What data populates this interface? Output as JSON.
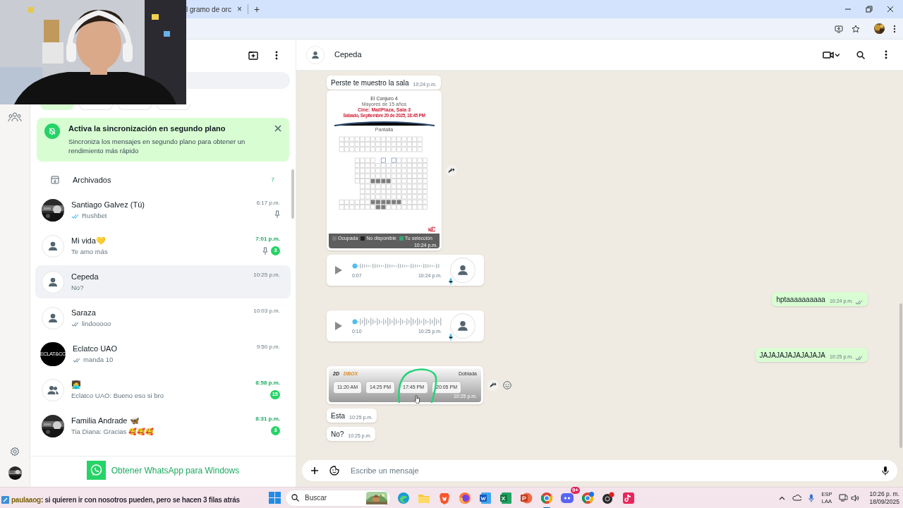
{
  "browser": {
    "tab_title": "l gramo de orc",
    "tab_close": "×",
    "new_tab": "+"
  },
  "stream_chat": {
    "user": "paulaaog",
    "text": ": si quieren ir con nosotros pueden, pero se hacen 3 filas atrás"
  },
  "sidebar": {
    "filters": [
      {
        "selected": true
      },
      {
        "selected": false
      },
      {
        "selected": false
      },
      {
        "selected": false
      }
    ],
    "sync_banner": {
      "title": "Activa la sincronización en segundo plano",
      "text": "Sincroniza los mensajes en segundo plano para obtener un rendimiento más rápido"
    },
    "archived": {
      "label": "Archivados",
      "count": "7"
    },
    "chats": [
      {
        "name": "Santiago Galvez (Tú)",
        "preview": "Rushbet",
        "time": "6:17 p.m.",
        "ticks_read": true,
        "pinned": true,
        "selected": false
      },
      {
        "name": "Mi vida💛",
        "preview": "Te amo más",
        "time": "7:01 p.m.",
        "avatar": {
          "kind": "person"
        },
        "pinned": true,
        "unread": "3",
        "selected": false
      },
      {
        "name": "Cepeda",
        "preview": "No?",
        "time": "10:25 p.m.",
        "avatar": {
          "kind": "person"
        },
        "pinned": false,
        "selected": true
      },
      {
        "name": "Saraza",
        "preview": "lindooooo",
        "time": "10:03 p.m.",
        "avatar": {
          "kind": "person"
        },
        "ticks_read": false,
        "pinned": false,
        "selected": false
      },
      {
        "name": "Eclatco UAO",
        "preview": "manda 10",
        "time": "9:50 p.m.",
        "avatar": {
          "kind": "logo",
          "text": "ECLAT&CO"
        },
        "ticks_read": false,
        "pinned": false,
        "selected": false
      },
      {
        "name": "🧑‍💻",
        "preview": "Eclatco UAO: Bueno eso si bro",
        "time": "8:58 p.m.",
        "avatar": {
          "kind": "group"
        },
        "pinned": false,
        "unread": "15",
        "selected": false
      },
      {
        "name": "Familia Andrade 🦋",
        "preview": "Tia Diana: Gracias 🥰🥰🥰",
        "time": "8:31 p.m.",
        "pinned": false,
        "unread": "3",
        "selected": false
      }
    ],
    "footer": "Obtener WhatsApp para Windows"
  },
  "chat": {
    "name": "Cepeda",
    "messages": [
      {
        "kind": "text",
        "outgoing": false,
        "text": "Perste te muestro la sala",
        "time": "10:24 p.m."
      },
      {
        "kind": "seat_map",
        "outgoing": false,
        "title": "El Conjuro 4",
        "rating": "Mayores de 15 años",
        "cinema": "Cine: MallPlaza, Sala 3",
        "date": "Sábado, Septiembre 20 de 2025, 18:45 PM",
        "screen": "Pantalla",
        "legend": [
          {
            "label": "Ocupada",
            "color": "#7a7a7a"
          },
          {
            "label": "No disponible",
            "color": "#222222"
          },
          {
            "label": "Tu selección",
            "color": "#3aa57a"
          }
        ],
        "time": "10:24 p.m."
      },
      {
        "kind": "voice",
        "outgoing": false,
        "duration": "0:07",
        "time": "10:24 p.m."
      },
      {
        "kind": "text",
        "outgoing": true,
        "text": "hptaaaaaaaaaa",
        "time": "10:24 p.m.",
        "ticks_read": false
      },
      {
        "kind": "voice",
        "outgoing": false,
        "duration": "0:10",
        "time": "10:25 p.m."
      },
      {
        "kind": "text",
        "outgoing": true,
        "text": "JAJAJAJAJAJAJAJA",
        "time": "10:25 p.m.",
        "ticks_read": false
      },
      {
        "kind": "showtimes",
        "outgoing": false,
        "format": "2D",
        "brand": "DBOX",
        "language": "Doblada",
        "times": [
          "11:20 AM",
          "14:25 PM",
          "17:45 PM",
          "20:05 PM"
        ],
        "time": "10:25 p.m."
      },
      {
        "kind": "text",
        "outgoing": false,
        "text": "Esta",
        "time": "10:25 p.m."
      },
      {
        "kind": "text",
        "outgoing": false,
        "text": "No?",
        "time": "10:25 p.m."
      }
    ],
    "composer": {
      "placeholder": "Escribe un mensaje"
    }
  },
  "taskbar": {
    "search": "Buscar",
    "discord_badge": "9+",
    "language": [
      "ESP",
      "LAA"
    ],
    "time": "10:26 p. m.",
    "date": "18/09/2025"
  }
}
